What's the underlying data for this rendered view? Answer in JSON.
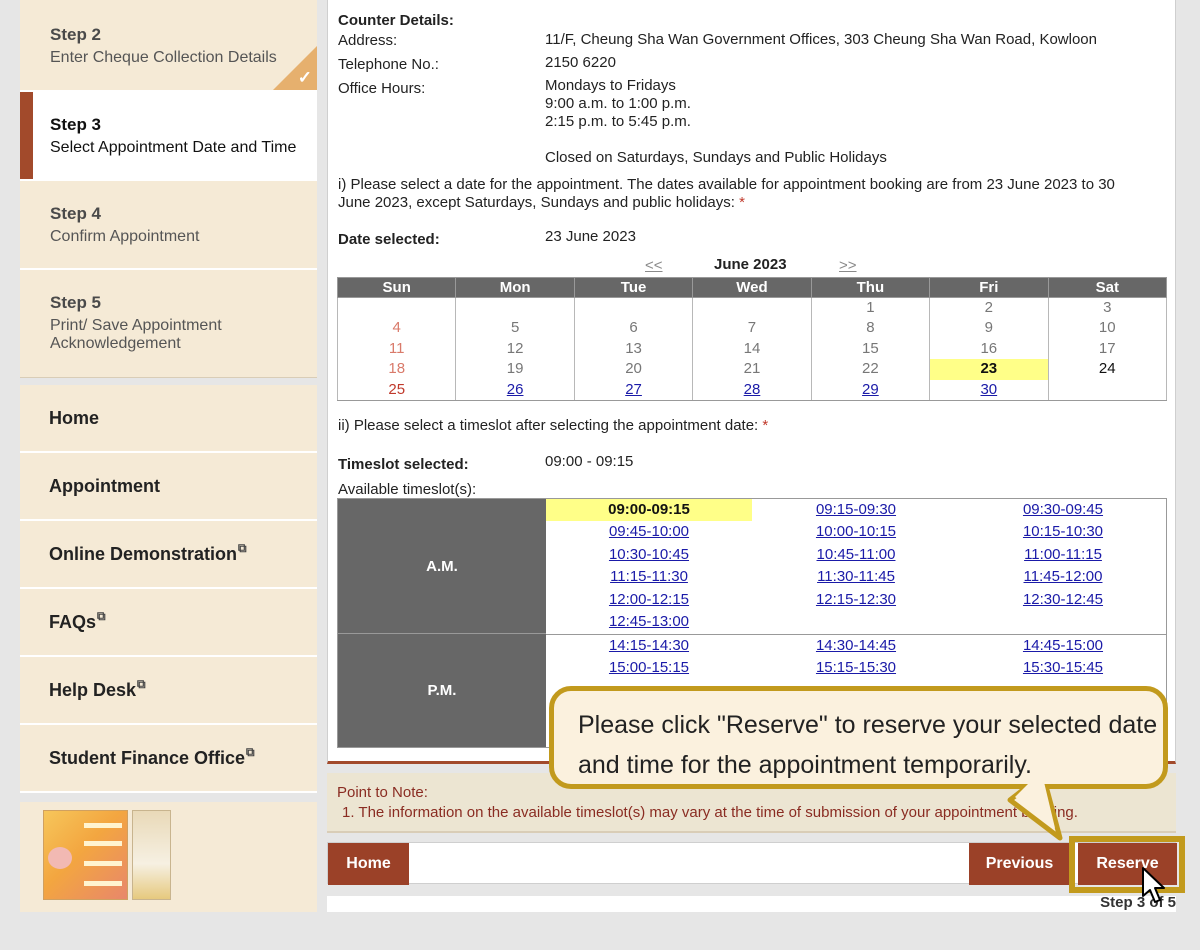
{
  "sidebar": {
    "steps": [
      {
        "title": "Step 2",
        "desc": "Enter Cheque Collection Details",
        "completed": true
      },
      {
        "title": "Step 3",
        "desc": "Select Appointment Date and Time",
        "current": true
      },
      {
        "title": "Step 4",
        "desc": "Confirm Appointment"
      },
      {
        "title": "Step 5",
        "desc": "Print/ Save Appointment Acknowledgement"
      }
    ],
    "nav": [
      {
        "label": "Home"
      },
      {
        "label": "Appointment"
      },
      {
        "label": "Online Demonstration"
      },
      {
        "label": "FAQs"
      },
      {
        "label": "Help Desk"
      },
      {
        "label": "Student Finance Office"
      }
    ],
    "check_mark": "✓",
    "external_link_glyph": "⧉"
  },
  "counter": {
    "heading": "Counter Details:",
    "address_label": "Address:",
    "address": "11/F, Cheung Sha Wan Government Offices, 303 Cheung Sha Wan Road, Kowloon",
    "telephone_label": "Telephone No.:",
    "telephone": "2150 6220",
    "hours_label": "Office Hours:",
    "hours": [
      "Mondays to Fridays",
      "9:00 a.m. to 1:00 p.m.",
      "2:15 p.m. to 5:45 p.m."
    ],
    "closed": "Closed on Saturdays, Sundays and Public Holidays"
  },
  "date_section": {
    "instruction_line1": "i) Please select a date for the appointment. The dates available for appointment booking are from 23 June 2023 to 30",
    "instruction_line2": "June 2023, except Saturdays, Sundays and public holidays:",
    "required_mark": "*",
    "selected_label": "Date selected:",
    "selected_value": "23 June 2023"
  },
  "calendar": {
    "prev": "<<",
    "next": ">>",
    "month": "June 2023",
    "weekdays": [
      "Sun",
      "Mon",
      "Tue",
      "Wed",
      "Thu",
      "Fri",
      "Sat"
    ],
    "weeks": [
      [
        "",
        "",
        "",
        "",
        "1",
        "2",
        "3"
      ],
      [
        "4",
        "5",
        "6",
        "7",
        "8",
        "9",
        "10"
      ],
      [
        "11",
        "12",
        "13",
        "14",
        "15",
        "16",
        "17"
      ],
      [
        "18",
        "19",
        "20",
        "21",
        "22",
        "23",
        "24"
      ],
      [
        "25",
        "26",
        "27",
        "28",
        "29",
        "30",
        ""
      ]
    ],
    "selected_date": "23",
    "available_links": [
      "26",
      "27",
      "28",
      "29",
      "30"
    ]
  },
  "timeslot_section": {
    "instruction": "ii) Please select a timeslot after selecting the appointment date:",
    "required_mark": "*",
    "selected_label": "Timeslot selected:",
    "selected_value": "09:00 - 09:15",
    "available_label": "Available timeslot(s):",
    "am_label": "A.M.",
    "pm_label": "P.M.",
    "am_slots": [
      "09:00-09:15",
      "09:15-09:30",
      "09:30-09:45",
      "09:45-10:00",
      "10:00-10:15",
      "10:15-10:30",
      "10:30-10:45",
      "10:45-11:00",
      "11:00-11:15",
      "11:15-11:30",
      "11:30-11:45",
      "11:45-12:00",
      "12:00-12:15",
      "12:15-12:30",
      "12:30-12:45",
      "12:45-13:00"
    ],
    "pm_slots": [
      "14:15-14:30",
      "14:30-14:45",
      "14:45-15:00",
      "15:00-15:15",
      "15:15-15:30",
      "15:30-15:45"
    ],
    "selected_slot": "09:00-09:15"
  },
  "note": {
    "title": "Point to Note:",
    "text": "1. The information on the available timeslot(s) may vary at the time of submission of your appointment booking."
  },
  "buttons": {
    "home": "Home",
    "previous": "Previous",
    "reserve": "Reserve"
  },
  "step_indicator": "Step 3 of 5",
  "callout": {
    "text": "Please click \"Reserve\" to reserve your selected date and time for the appointment temporarily."
  },
  "colors": {
    "accent": "#9b4128",
    "highlight": "#ffff88",
    "callout_border": "#c29a1d",
    "sidebar_bg": "#f5ead6"
  }
}
